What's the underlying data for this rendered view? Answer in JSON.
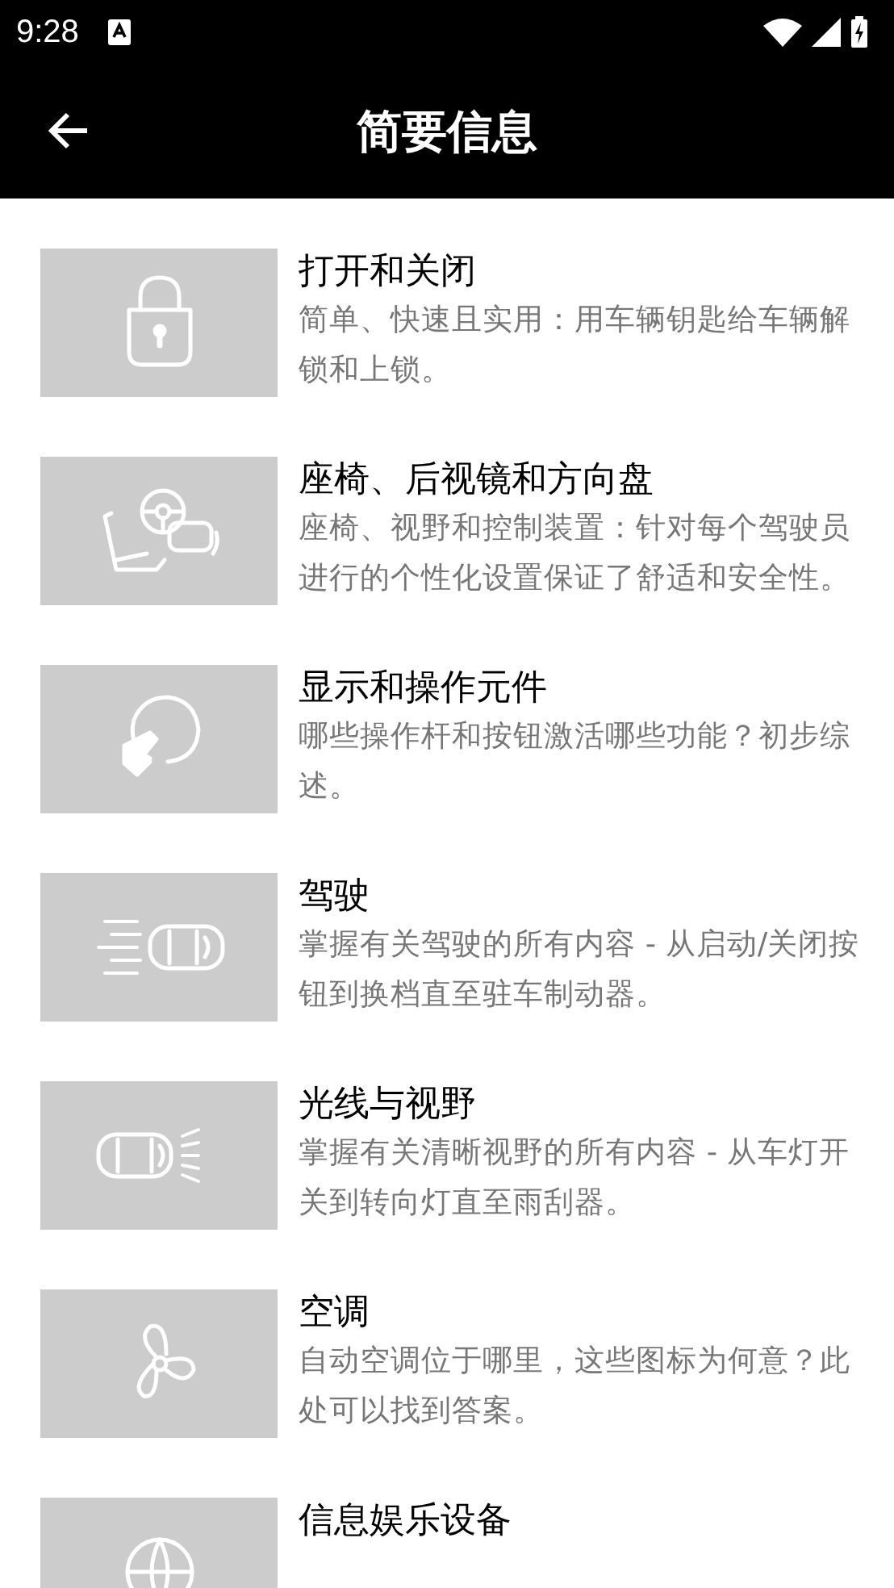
{
  "status_bar": {
    "time": "9:28"
  },
  "toolbar": {
    "title": "简要信息"
  },
  "items": [
    {
      "title": "打开和关闭",
      "description": "简单、快速且实用：用车辆钥匙给车辆解锁和上锁。"
    },
    {
      "title": "座椅、后视镜和方向盘",
      "description": "座椅、视野和控制装置：针对每个驾驶员进行的个性化设置保证了舒适和安全性。"
    },
    {
      "title": "显示和操作元件",
      "description": "哪些操作杆和按钮激活哪些功能？初步综述。"
    },
    {
      "title": "驾驶",
      "description": "掌握有关驾驶的所有内容 - 从启动/关闭按钮到换档直至驻车制动器。"
    },
    {
      "title": "光线与视野",
      "description": "掌握有关清晰视野的所有内容 - 从车灯开关到转向灯直至雨刮器。"
    },
    {
      "title": "空调",
      "description": "自动空调位于哪里，这些图标为何意？此处可以找到答案。"
    },
    {
      "title": "信息娱乐设备"
    }
  ]
}
